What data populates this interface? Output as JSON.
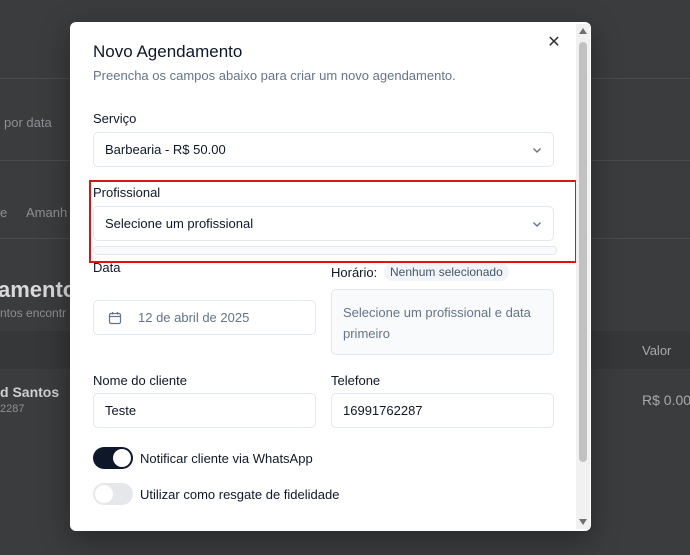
{
  "background": {
    "filter_placeholder": "por data",
    "tab_partial": "e",
    "tab_tomorrow_partial": "Amanh",
    "heading_partial": "amentos",
    "subheading_partial": "ntos encontr",
    "column_value": "Valor",
    "row_name_partial": "d Santos",
    "row_phone_partial": "2287",
    "row_value": "R$ 0.00"
  },
  "modal": {
    "title": "Novo Agendamento",
    "subtitle": "Preencha os campos abaixo para criar um novo agendamento.",
    "close_icon": "close-icon",
    "service": {
      "label": "Serviço",
      "value": "Barbearia - R$ 50.00"
    },
    "professional": {
      "label": "Profissional",
      "value": "Selecione um profissional"
    },
    "date": {
      "label": "Data",
      "value": "12 de abril de 2025"
    },
    "time": {
      "label": "Horário:",
      "badge": "Nenhum selecionado",
      "hint": "Selecione um profissional e data primeiro"
    },
    "client_name": {
      "label": "Nome do cliente",
      "value": "Teste"
    },
    "phone": {
      "label": "Telefone",
      "value": "16991762287"
    },
    "whatsapp_toggle": {
      "label": "Notificar cliente via WhatsApp",
      "on": true
    },
    "loyalty_toggle": {
      "label": "Utilizar como resgate de fidelidade",
      "on": false
    }
  },
  "colors": {
    "highlight": "#dc1414",
    "toggle_on": "#0f172a",
    "toggle_off": "#e5e7eb"
  }
}
